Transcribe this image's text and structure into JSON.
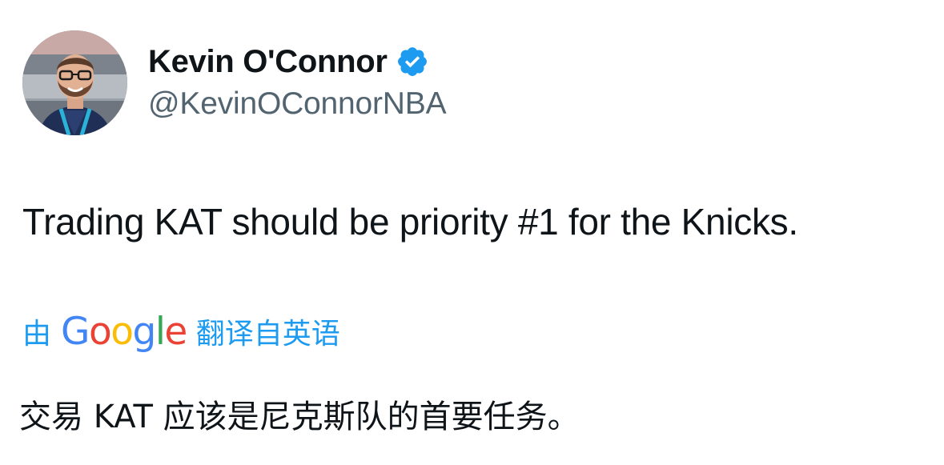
{
  "author": {
    "display_name": "Kevin O'Connor",
    "handle": "@KevinOConnorNBA",
    "verified": true,
    "avatar_icon": "profile-photo"
  },
  "tweet": {
    "text": "Trading KAT should be priority #1 for the Knicks."
  },
  "translation": {
    "prefix": "由",
    "provider": [
      "G",
      "o",
      "o",
      "g",
      "l",
      "e"
    ],
    "suffix": "翻译自英语",
    "text": "交易 KAT 应该是尼克斯队的首要任务。"
  },
  "colors": {
    "text_primary": "#0f1419",
    "text_secondary": "#536471",
    "accent_blue": "#1d9bf0",
    "google_blue": "#4285f4",
    "google_red": "#ea4335",
    "google_yellow": "#fbbc05",
    "google_green": "#34a853"
  }
}
